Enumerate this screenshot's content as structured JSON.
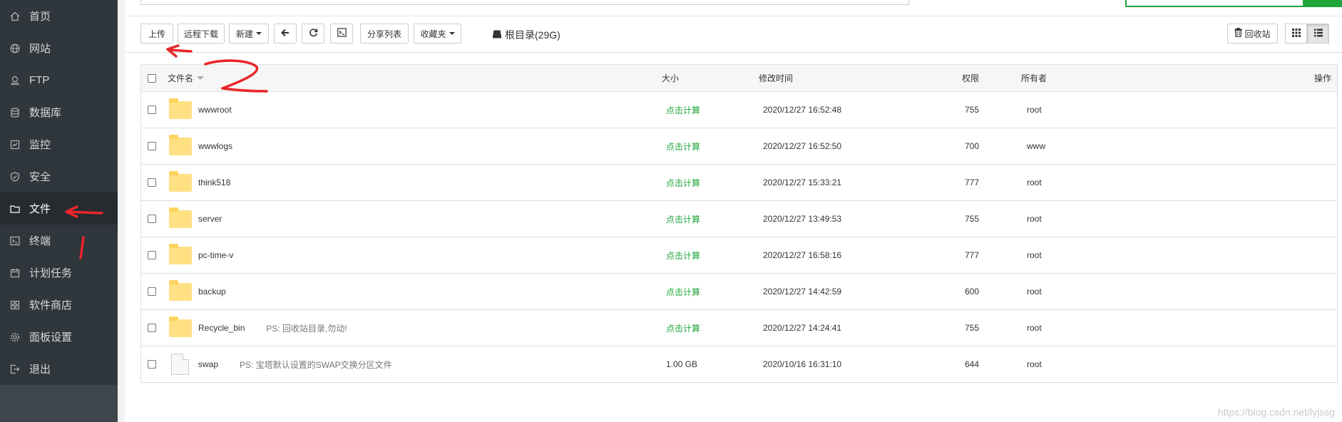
{
  "sidebar": {
    "items": [
      {
        "label": "首页",
        "icon": "home-icon"
      },
      {
        "label": "网站",
        "icon": "globe-icon"
      },
      {
        "label": "FTP",
        "icon": "ftp-icon"
      },
      {
        "label": "数据库",
        "icon": "database-icon"
      },
      {
        "label": "监控",
        "icon": "monitor-icon"
      },
      {
        "label": "安全",
        "icon": "shield-icon"
      },
      {
        "label": "文件",
        "icon": "folder-icon",
        "active": true
      },
      {
        "label": "终端",
        "icon": "terminal-icon"
      },
      {
        "label": "计划任务",
        "icon": "calendar-icon"
      },
      {
        "label": "软件商店",
        "icon": "grid-icon"
      },
      {
        "label": "面板设置",
        "icon": "gear-icon"
      },
      {
        "label": "退出",
        "icon": "logout-icon"
      }
    ]
  },
  "toolbar": {
    "upload": "上传",
    "remote_download": "远程下载",
    "new": "新建",
    "share_list": "分享列表",
    "favorites": "收藏夹",
    "disk_label": "根目录(29G)",
    "recycle_bin": "回收站"
  },
  "table": {
    "headers": {
      "name": "文件名",
      "size": "大小",
      "mtime": "修改时间",
      "perm": "权限",
      "owner": "所有者",
      "ops": "操作"
    },
    "rows": [
      {
        "type": "folder",
        "name": "wwwroot",
        "note": "",
        "size": "点击计算",
        "mtime": "2020/12/27 16:52:48",
        "perm": "755",
        "owner": "root"
      },
      {
        "type": "folder",
        "name": "wwwlogs",
        "note": "",
        "size": "点击计算",
        "mtime": "2020/12/27 16:52:50",
        "perm": "700",
        "owner": "www"
      },
      {
        "type": "folder",
        "name": "think518",
        "note": "",
        "size": "点击计算",
        "mtime": "2020/12/27 15:33:21",
        "perm": "777",
        "owner": "root"
      },
      {
        "type": "folder",
        "name": "server",
        "note": "",
        "size": "点击计算",
        "mtime": "2020/12/27 13:49:53",
        "perm": "755",
        "owner": "root"
      },
      {
        "type": "folder",
        "name": "pc-time-v",
        "note": "",
        "size": "点击计算",
        "mtime": "2020/12/27 16:58:16",
        "perm": "777",
        "owner": "root"
      },
      {
        "type": "folder",
        "name": "backup",
        "note": "",
        "size": "点击计算",
        "mtime": "2020/12/27 14:42:59",
        "perm": "600",
        "owner": "root"
      },
      {
        "type": "folder",
        "name": "Recycle_bin",
        "note": "PS: 回收站目录,勿动!",
        "size": "点击计算",
        "mtime": "2020/12/27 14:24:41",
        "perm": "755",
        "owner": "root"
      },
      {
        "type": "file",
        "name": "swap",
        "note": "PS: 宝塔默认设置的SWAP交换分区文件",
        "size": "1.00 GB",
        "mtime": "2020/10/16 16:31:10",
        "perm": "644",
        "owner": "root"
      }
    ]
  },
  "watermark": "https://blog.csdn.net/lyjssg",
  "colors": {
    "accent": "#20a53a",
    "sidebar": "#2f363c",
    "annotation": "#e8262b"
  }
}
